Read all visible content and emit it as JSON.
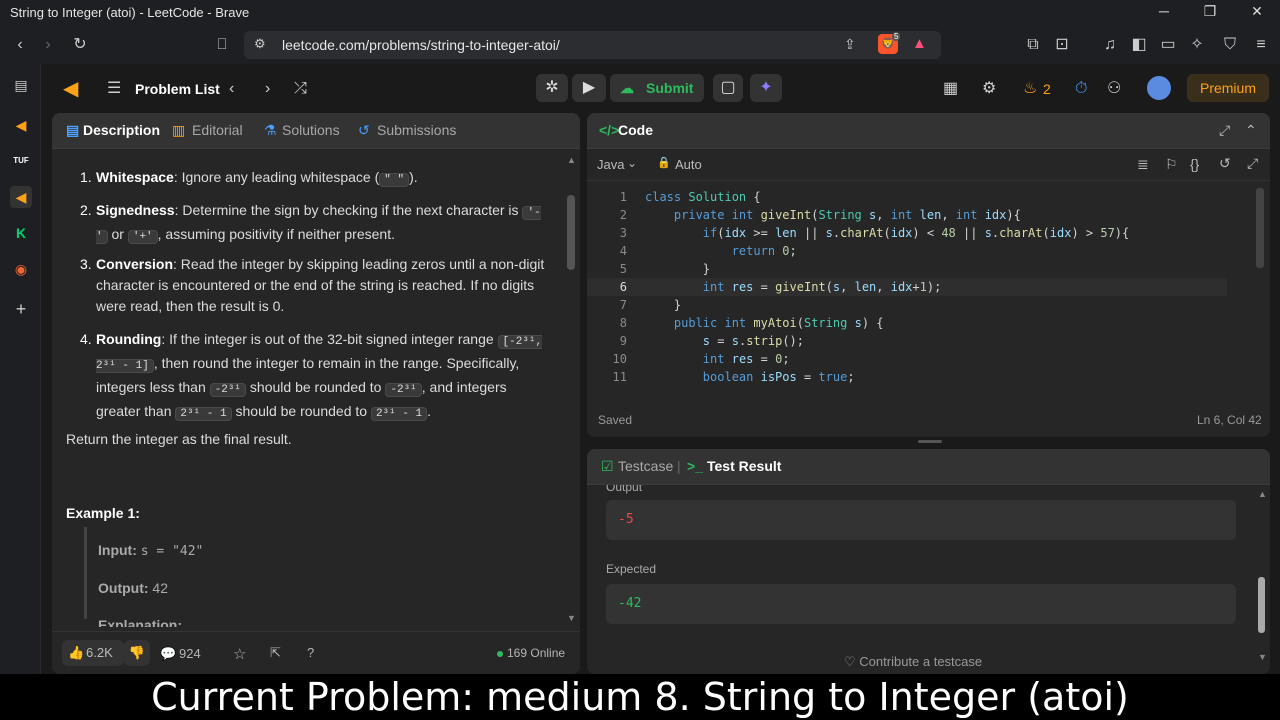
{
  "browser": {
    "window_title": "String to Integer (atoi) - LeetCode - Brave",
    "url": "leetcode.com/problems/string-to-integer-atoi/",
    "brave_badge": "5"
  },
  "topnav": {
    "problem_list": "Problem List",
    "submit": "Submit",
    "streak": "2",
    "premium": "Premium"
  },
  "left_panel": {
    "tabs": [
      "Description",
      "Editorial",
      "Solutions",
      "Submissions"
    ],
    "steps": [
      {
        "num": "1.",
        "title": "Whitespace",
        "text": ": Ignore any leading whitespace (",
        "code": "\" \"",
        "tail": ")."
      },
      {
        "num": "2.",
        "title": "Signedness",
        "text_a": ": Determine the sign by checking if the next character is ",
        "code_a": "'-'",
        "text_b": " or ",
        "code_b": "'+'",
        "text_c": ", assuming positivity if neither present."
      },
      {
        "num": "3.",
        "title": "Conversion",
        "text": ": Read the integer by skipping leading zeros until a non-digit character is encountered or the end of the string is reached. If no digits were read, then the result is 0."
      },
      {
        "num": "4.",
        "title": "Rounding",
        "text_a": ": If the integer is out of the 32-bit signed integer range ",
        "code_a": "[-2³¹, 2³¹ - 1]",
        "text_b": ", then round the integer to remain in the range. Specifically, integers less than ",
        "code_b": "-2³¹",
        "text_c": " should be rounded to ",
        "code_c": "-2³¹",
        "text_d": ", and integers greater than ",
        "code_d": "2³¹ - 1",
        "text_e": " should be rounded to ",
        "code_e": "2³¹ - 1",
        "text_f": "."
      }
    ],
    "return_text": "Return the integer as the final result.",
    "example_title": "Example 1:",
    "input_label": "Input:",
    "input_value": "s = \"42\"",
    "output_label": "Output:",
    "output_value": "42",
    "explanation_label": "Explanation:",
    "likes": "6.2K",
    "comments": "924",
    "online": "169 Online"
  },
  "code_panel": {
    "title": "Code",
    "language": "Java",
    "mode": "Auto",
    "status": "Saved",
    "cursor": "Ln 6, Col 42",
    "lines": [
      {
        "n": "1",
        "html": "<span class='kw'>class</span> <span class='cls'>Solution</span> {"
      },
      {
        "n": "2",
        "html": "    <span class='kw'>private int</span> <span class='fn'>giveInt</span>(<span class='cls'>String</span> <span class='var'>s</span>, <span class='kw'>int</span> <span class='var'>len</span>, <span class='kw'>int</span> <span class='var'>idx</span>){"
      },
      {
        "n": "3",
        "html": "        <span class='kw'>if</span>(<span class='var'>idx</span> >= <span class='var'>len</span> || <span class='var'>s</span>.<span class='fn'>charAt</span>(<span class='var'>idx</span>) < <span class='num'>48</span> || <span class='var'>s</span>.<span class='fn'>charAt</span>(<span class='var'>idx</span>) > <span class='num'>57</span>){"
      },
      {
        "n": "4",
        "html": "            <span class='kw'>return</span> <span class='num'>0</span>;"
      },
      {
        "n": "5",
        "html": "        }"
      },
      {
        "n": "6",
        "html": "        <span class='kw'>int</span> <span class='var'>res</span> = <span class='fn'>giveInt</span>(<span class='var'>s</span>, <span class='var'>len</span>, <span class='var'>idx</span>+<span class='num'>1</span>);"
      },
      {
        "n": "7",
        "html": "    }"
      },
      {
        "n": "8",
        "html": "    <span class='kw'>public int</span> <span class='fn'>myAtoi</span>(<span class='cls'>String</span> <span class='var'>s</span>) {"
      },
      {
        "n": "9",
        "html": "        <span class='var'>s</span> = <span class='var'>s</span>.<span class='fn'>strip</span>();"
      },
      {
        "n": "10",
        "html": "        <span class='kw'>int</span> <span class='var'>res</span> = <span class='num'>0</span>;"
      },
      {
        "n": "11",
        "html": "        <span class='kw'>boolean</span> <span class='var'>isPos</span> = <span class='kw'>true</span>;"
      }
    ]
  },
  "test_panel": {
    "tabs": [
      "Testcase",
      "Test Result"
    ],
    "output_label": "Output",
    "output_value": "-5",
    "expected_label": "Expected",
    "expected_value": "-42",
    "contribute": "Contribute a testcase"
  },
  "caption": "Current Problem: medium 8. String to Integer (atoi)"
}
